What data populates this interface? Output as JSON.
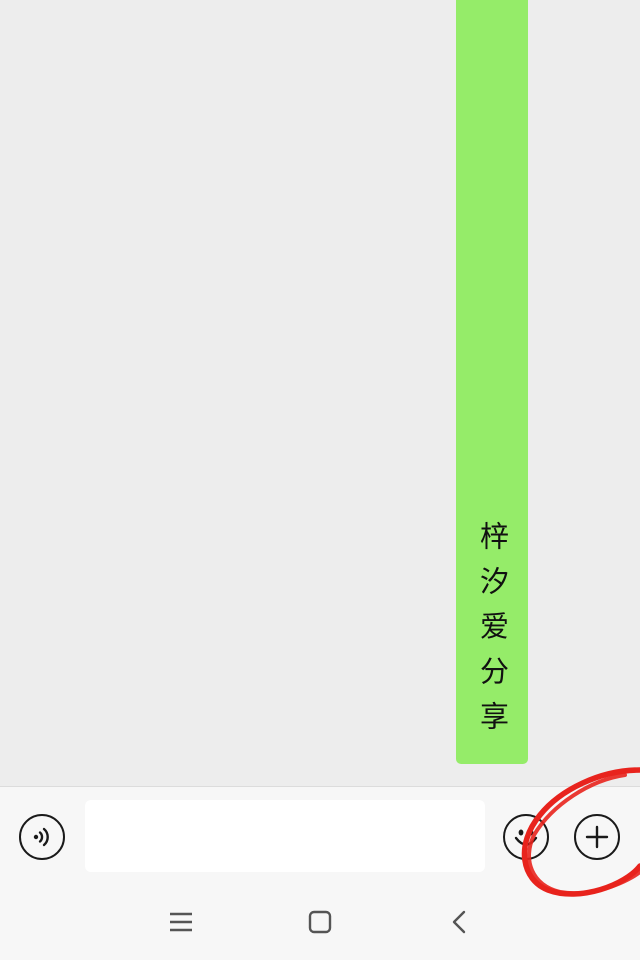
{
  "chat": {
    "message": "梓汐爱分享"
  },
  "input_bar": {
    "text_value": "",
    "icons": [
      "voice-icon",
      "emoji-icon",
      "plus-icon"
    ]
  },
  "nav_bar": {
    "icons": [
      "menu-icon",
      "home-icon",
      "back-icon"
    ]
  },
  "colors": {
    "chat_background": "#ededed",
    "bubble": "#95ec69",
    "input_bar": "#f7f7f7",
    "annotation": "#e8231d"
  }
}
